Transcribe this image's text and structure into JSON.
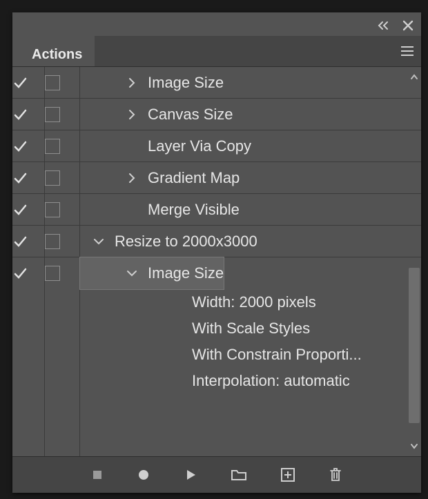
{
  "panel": {
    "title": "Actions"
  },
  "rows": [
    {
      "label": "Image Size",
      "checked": true,
      "dialog": true,
      "chevron": "right",
      "indent": 2,
      "selected": false
    },
    {
      "label": "Canvas Size",
      "checked": true,
      "dialog": true,
      "chevron": "right",
      "indent": 2,
      "selected": false
    },
    {
      "label": "Layer Via Copy",
      "checked": true,
      "dialog": true,
      "chevron": "none",
      "indent": 2,
      "selected": false
    },
    {
      "label": "Gradient Map",
      "checked": true,
      "dialog": true,
      "chevron": "right",
      "indent": 2,
      "selected": false
    },
    {
      "label": "Merge Visible",
      "checked": true,
      "dialog": true,
      "chevron": "none",
      "indent": 2,
      "selected": false
    },
    {
      "label": "Resize to 2000x3000",
      "checked": true,
      "dialog": true,
      "chevron": "down",
      "indent": 1,
      "selected": false
    },
    {
      "label": "Image Size",
      "checked": true,
      "dialog": true,
      "chevron": "down",
      "indent": 2,
      "selected": true
    }
  ],
  "details": [
    "Width: 2000 pixels",
    "With Scale Styles",
    "With Constrain Proporti...",
    "Interpolation: automatic"
  ],
  "footer": {
    "stop": "Stop",
    "record": "Record",
    "play": "Play",
    "folder": "Create Set",
    "new": "Create Action",
    "trash": "Delete"
  }
}
